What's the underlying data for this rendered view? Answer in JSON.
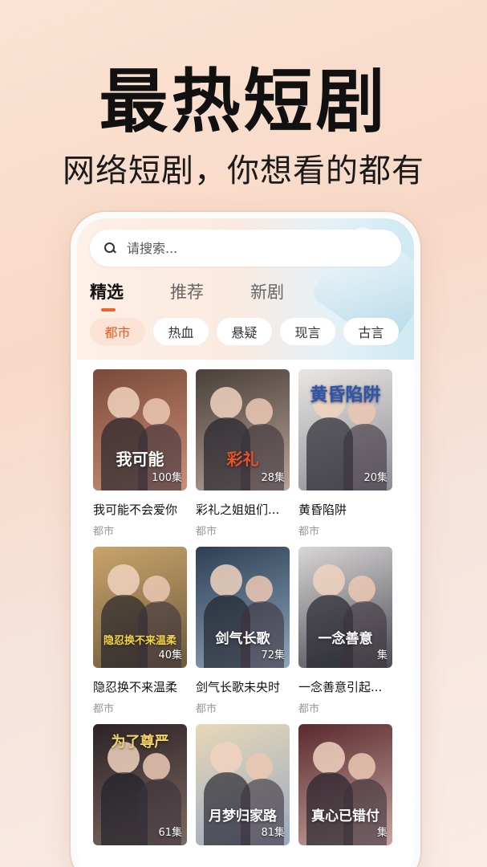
{
  "promo": {
    "headline": "最热短剧",
    "subheadline": "网络短剧，你想看的都有"
  },
  "search": {
    "placeholder": "请搜索..."
  },
  "tabs": [
    {
      "label": "精选",
      "active": true
    },
    {
      "label": "推荐",
      "active": false
    },
    {
      "label": "新剧",
      "active": false
    }
  ],
  "chips": [
    {
      "label": "都市",
      "active": true
    },
    {
      "label": "热血",
      "active": false
    },
    {
      "label": "悬疑",
      "active": false
    },
    {
      "label": "现言",
      "active": false
    },
    {
      "label": "古言",
      "active": false
    }
  ],
  "dramas": [
    {
      "title": "我可能不会爱你",
      "genre": "都市",
      "episodes": "100集",
      "poster_art": "我可能",
      "colors": [
        "#7c4a3a",
        "#c98f78"
      ],
      "art_color": "#fff"
    },
    {
      "title": "彩礼之姐姐们...",
      "genre": "都市",
      "episodes": "28集",
      "poster_art": "彩礼",
      "colors": [
        "#4a3f3a",
        "#b7a49a"
      ],
      "art_color": "#e8542a"
    },
    {
      "title": "黄昏陷阱",
      "genre": "都市",
      "episodes": "20集",
      "poster_art": "黄昏陷阱",
      "colors": [
        "#e9e6e2",
        "#8d8a96"
      ],
      "art_color": "#2a55b0"
    },
    {
      "title": "隐忍换不来温柔",
      "genre": "都市",
      "episodes": "40集",
      "poster_art": "隐忍换不来温柔",
      "colors": [
        "#c9a46b",
        "#6b5a3c"
      ],
      "art_color": "#f5d44a"
    },
    {
      "title": "剑气长歌未央时",
      "genre": "都市",
      "episodes": "72集",
      "poster_art": "剑气长歌",
      "colors": [
        "#2d3f55",
        "#8fa6bd"
      ],
      "art_color": "#ffffff"
    },
    {
      "title": "一念善意引起...",
      "genre": "都市",
      "episodes": "集",
      "poster_art": "一念善意",
      "colors": [
        "#d8d6d6",
        "#4b4a52"
      ],
      "art_color": "#ffffff"
    },
    {
      "title": "",
      "genre": "",
      "episodes": "61集",
      "poster_art": "为了尊严",
      "colors": [
        "#2c2226",
        "#7d6b62"
      ],
      "art_color": "#f2d26a"
    },
    {
      "title": "",
      "genre": "",
      "episodes": "81集",
      "poster_art": "月梦归家路",
      "colors": [
        "#e7d8b8",
        "#98a8c0"
      ],
      "art_color": "#ffffff"
    },
    {
      "title": "",
      "genre": "",
      "episodes": "集",
      "poster_art": "真心已错付",
      "colors": [
        "#5a2a2e",
        "#c7a5a0"
      ],
      "art_color": "#ffffff"
    }
  ]
}
